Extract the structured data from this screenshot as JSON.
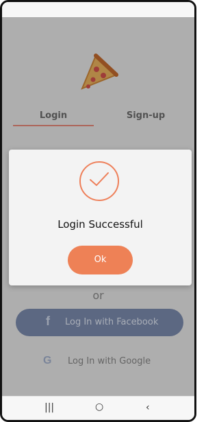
{
  "screen": {
    "logo_alt": "pizza-slice-logo",
    "tabs": {
      "login": "Login",
      "signup": "Sign-up"
    },
    "social": {
      "or": "or",
      "facebook": "Log In with Facebook",
      "google": "Log In with Google"
    },
    "dialog": {
      "title": "Login Successful",
      "ok": "Ok"
    },
    "nav": {
      "recent": "|||",
      "home": "○",
      "back": "‹"
    },
    "colors": {
      "accent": "#ee8156",
      "check": "#ee7f59",
      "facebook": "#7f8fb2"
    }
  }
}
